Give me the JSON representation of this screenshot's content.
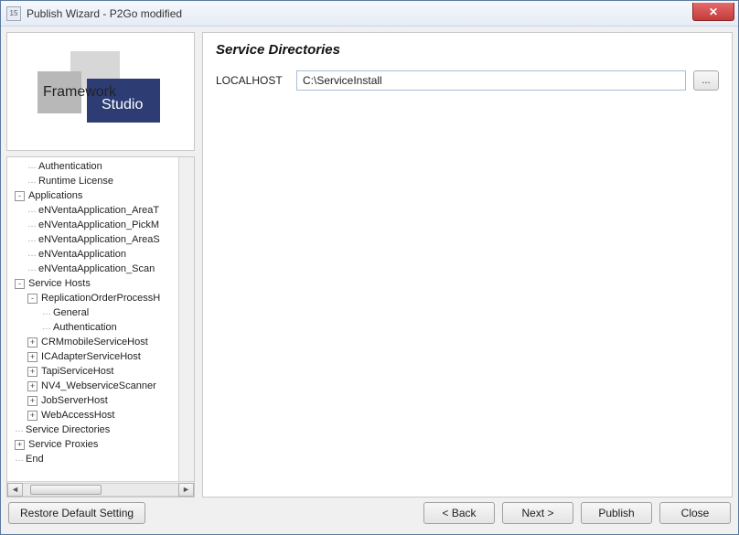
{
  "window": {
    "title": "Publish Wizard - P2Go modified",
    "icon_label": "15"
  },
  "logo": {
    "line1": "Framework",
    "line2": "Studio"
  },
  "tree": [
    {
      "label": "Authentication",
      "indent": 1,
      "toggle": ""
    },
    {
      "label": "Runtime License",
      "indent": 1,
      "toggle": ""
    },
    {
      "label": "Applications",
      "indent": 0,
      "toggle": "-"
    },
    {
      "label": "eNVentaApplication_AreaT",
      "indent": 1,
      "toggle": ""
    },
    {
      "label": "eNVentaApplication_PickM",
      "indent": 1,
      "toggle": ""
    },
    {
      "label": "eNVentaApplication_AreaS",
      "indent": 1,
      "toggle": ""
    },
    {
      "label": "eNVentaApplication",
      "indent": 1,
      "toggle": ""
    },
    {
      "label": "eNVentaApplication_Scan",
      "indent": 1,
      "toggle": ""
    },
    {
      "label": "Service Hosts",
      "indent": 0,
      "toggle": "-"
    },
    {
      "label": "ReplicationOrderProcessH",
      "indent": 1,
      "toggle": "-"
    },
    {
      "label": "General",
      "indent": 2,
      "toggle": ""
    },
    {
      "label": "Authentication",
      "indent": 2,
      "toggle": ""
    },
    {
      "label": "CRMmobileServiceHost",
      "indent": 1,
      "toggle": "+"
    },
    {
      "label": "ICAdapterServiceHost",
      "indent": 1,
      "toggle": "+"
    },
    {
      "label": "TapiServiceHost",
      "indent": 1,
      "toggle": "+"
    },
    {
      "label": "NV4_WebserviceScanner",
      "indent": 1,
      "toggle": "+"
    },
    {
      "label": "JobServerHost",
      "indent": 1,
      "toggle": "+"
    },
    {
      "label": "WebAccessHost",
      "indent": 1,
      "toggle": "+"
    },
    {
      "label": "Service Directories",
      "indent": 0,
      "toggle": ""
    },
    {
      "label": "Service Proxies",
      "indent": 0,
      "toggle": "+"
    },
    {
      "label": "End",
      "indent": 0,
      "toggle": ""
    }
  ],
  "right": {
    "heading": "Service Directories",
    "field_label": "LOCALHOST",
    "field_value": "C:\\ServiceInstall",
    "browse_label": "..."
  },
  "buttons": {
    "restore": "Restore Default Setting",
    "back": "< Back",
    "next": "Next >",
    "publish": "Publish",
    "close": "Close"
  }
}
